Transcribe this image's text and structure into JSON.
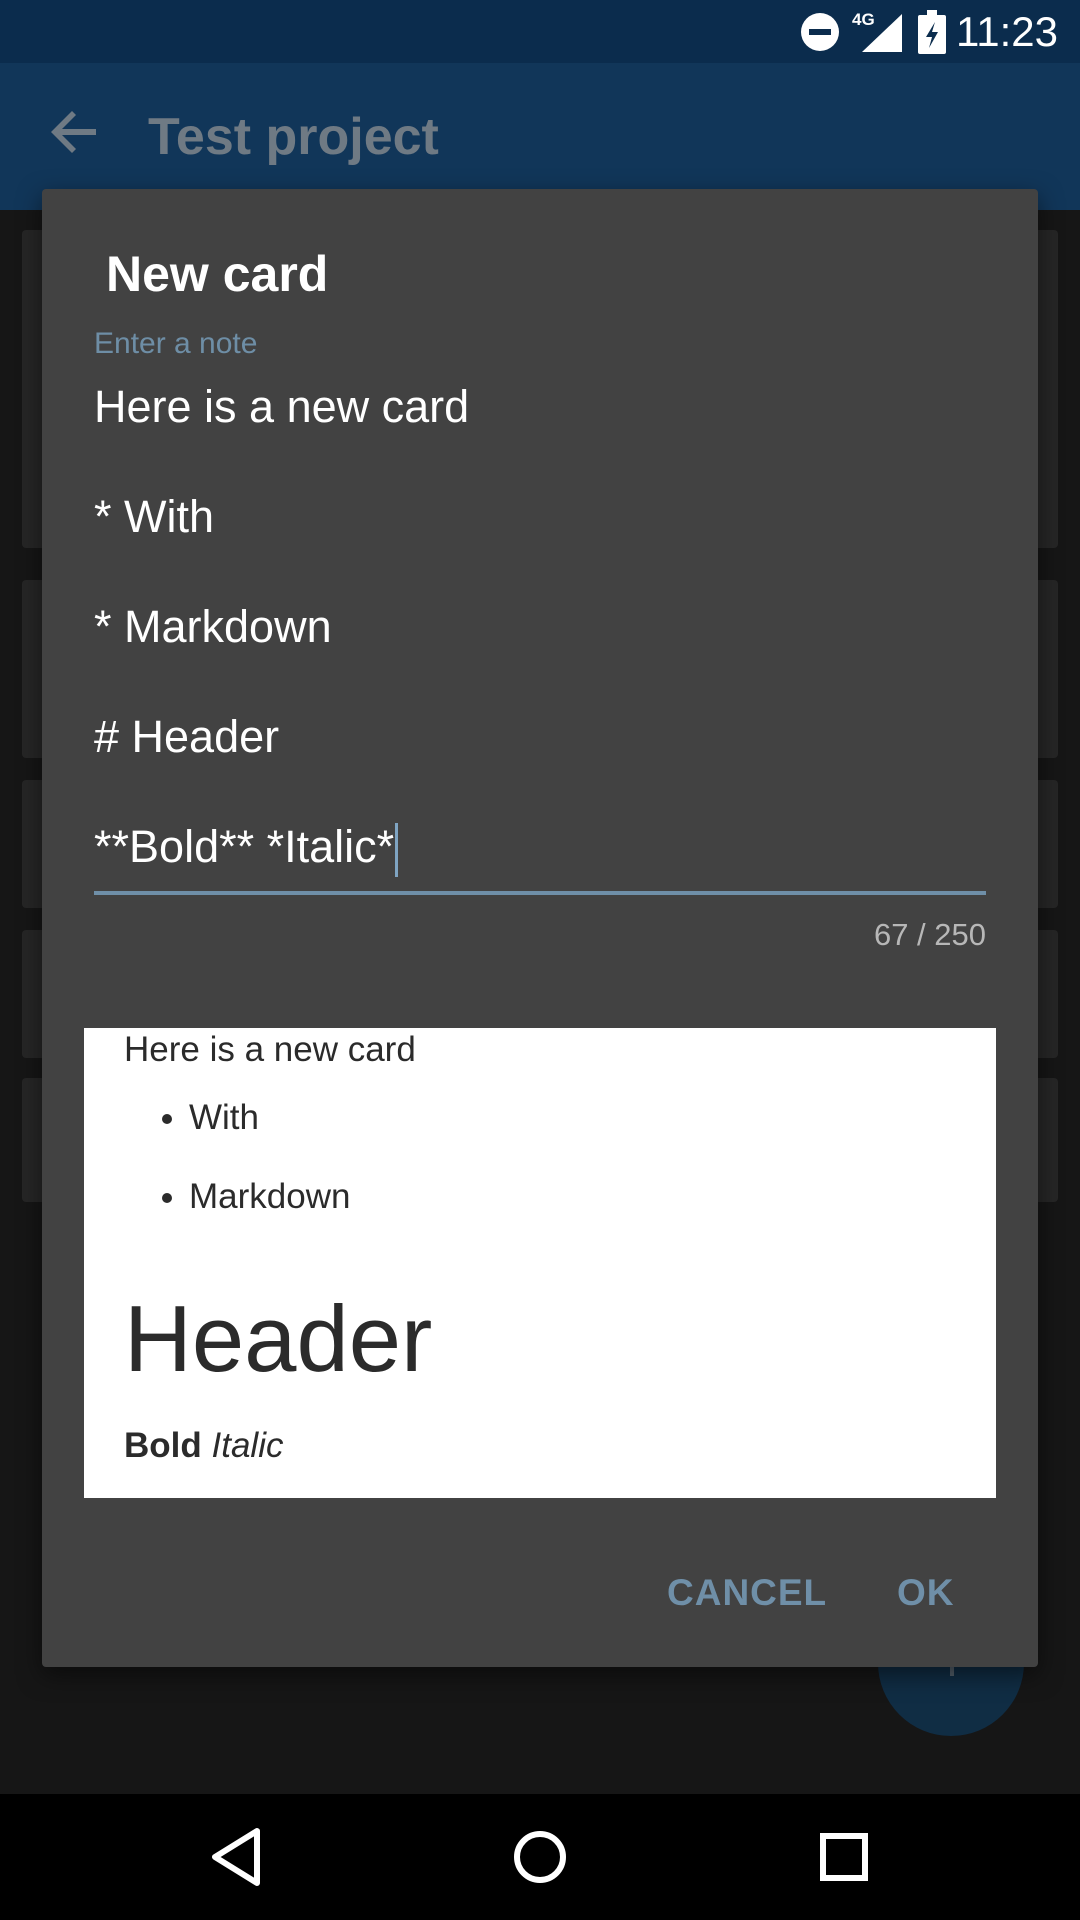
{
  "status_bar": {
    "time": "11:23",
    "network": "4G",
    "icons": [
      "do-not-disturb-icon",
      "signal-icon",
      "battery-icon"
    ]
  },
  "app_bar": {
    "title": "Test project",
    "back_icon": "arrow-back-icon"
  },
  "dialog": {
    "title": "New card",
    "hint": "Enter a note",
    "input_lines": [
      "Here is a new card",
      "* With",
      "* Markdown",
      "# Header",
      "**Bold** *Italic*"
    ],
    "counter": "67 / 250",
    "preview": {
      "paragraph": "Here is a new card",
      "list": [
        "With",
        "Markdown"
      ],
      "heading": "Header",
      "bold": "Bold",
      "italic": "Italic"
    },
    "cancel_label": "CANCEL",
    "ok_label": "OK"
  },
  "colors": {
    "status_bar": "#0b2c4d",
    "app_bar": "#113659",
    "dialog_bg": "#424242",
    "accent": "#6f8fa8",
    "preview_bg": "#ffffff"
  },
  "nav_bar": {
    "icons": [
      "nav-back-icon",
      "nav-home-icon",
      "nav-recents-icon"
    ]
  }
}
